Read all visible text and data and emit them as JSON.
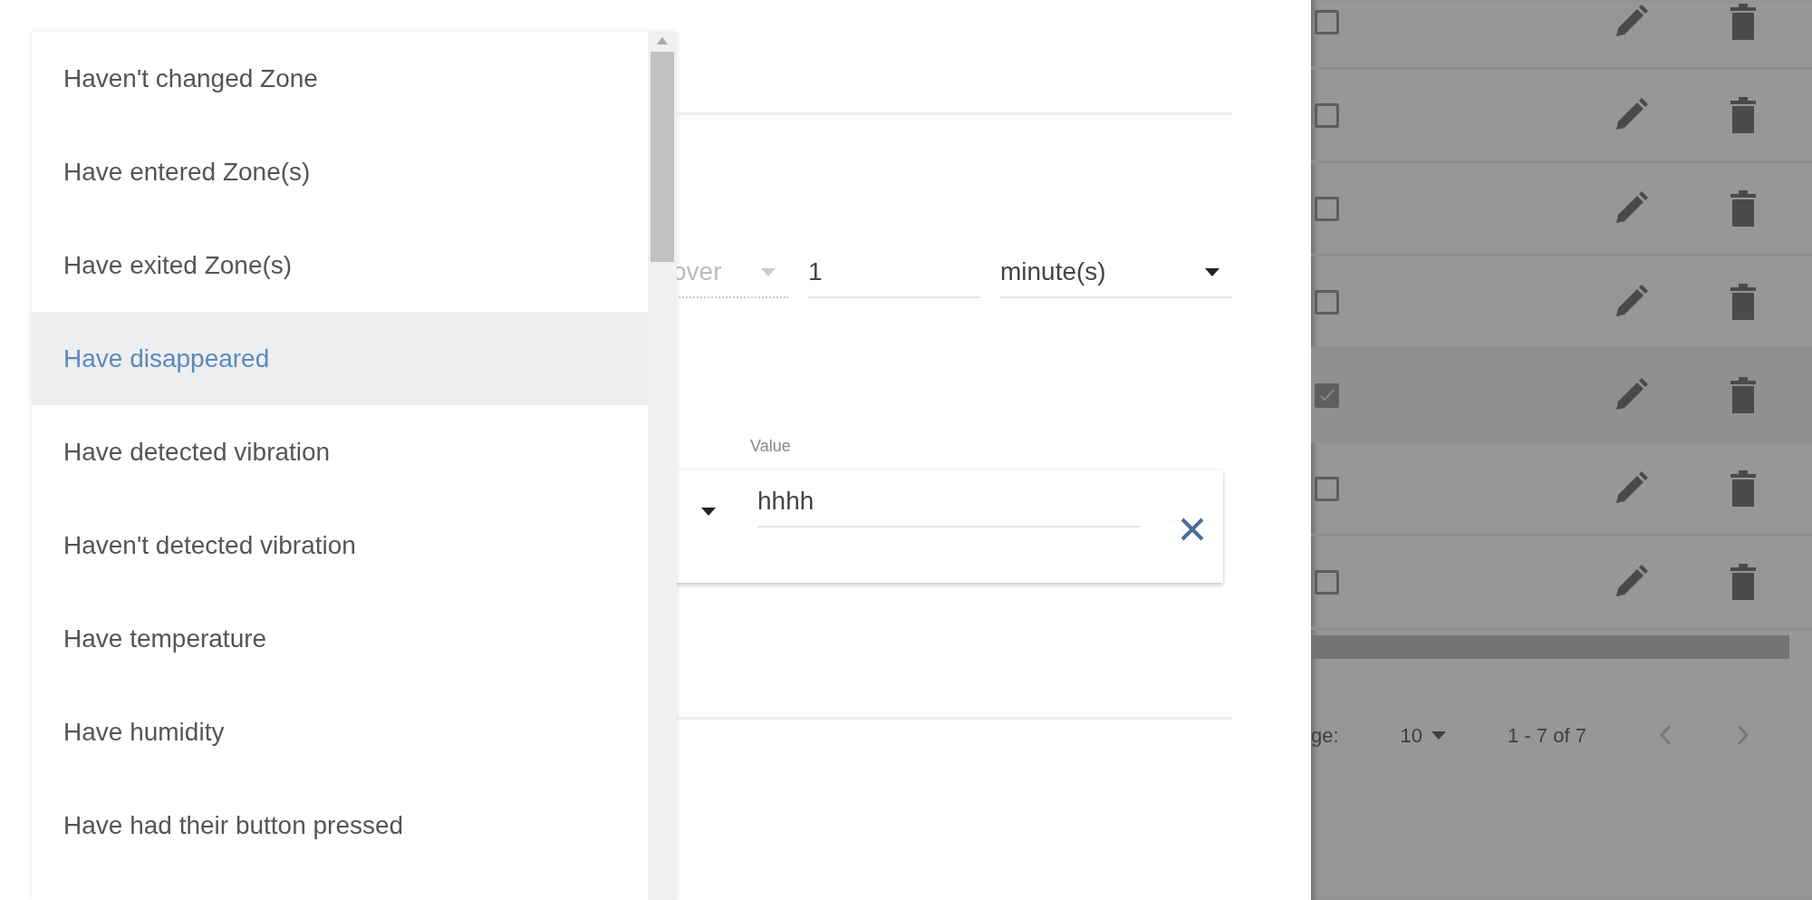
{
  "menu": {
    "items": [
      {
        "label": "Haven't changed Zone",
        "selected": false
      },
      {
        "label": "Have entered Zone(s)",
        "selected": false
      },
      {
        "label": "Have exited Zone(s)",
        "selected": false
      },
      {
        "label": "Have disappeared",
        "selected": true
      },
      {
        "label": "Have detected vibration",
        "selected": false
      },
      {
        "label": "Haven't detected vibration",
        "selected": false
      },
      {
        "label": "Have temperature",
        "selected": false
      },
      {
        "label": "Have humidity",
        "selected": false
      },
      {
        "label": "Have had their button pressed",
        "selected": false
      }
    ]
  },
  "form": {
    "period_select": {
      "text": "over",
      "disabled": true
    },
    "count_field": {
      "value": "1"
    },
    "unit_select": {
      "text": "minute(s)",
      "disabled": false
    },
    "condition": {
      "value_label": "Value",
      "value": "hhhh"
    }
  },
  "table": {
    "rows": [
      {
        "checked": false
      },
      {
        "checked": false
      },
      {
        "checked": false
      },
      {
        "checked": false
      },
      {
        "checked": true
      },
      {
        "checked": false
      },
      {
        "checked": false
      }
    ],
    "pagination": {
      "rows_label": "ge:",
      "rows_per_page": "10",
      "range": "1 - 7 of 7"
    }
  }
}
